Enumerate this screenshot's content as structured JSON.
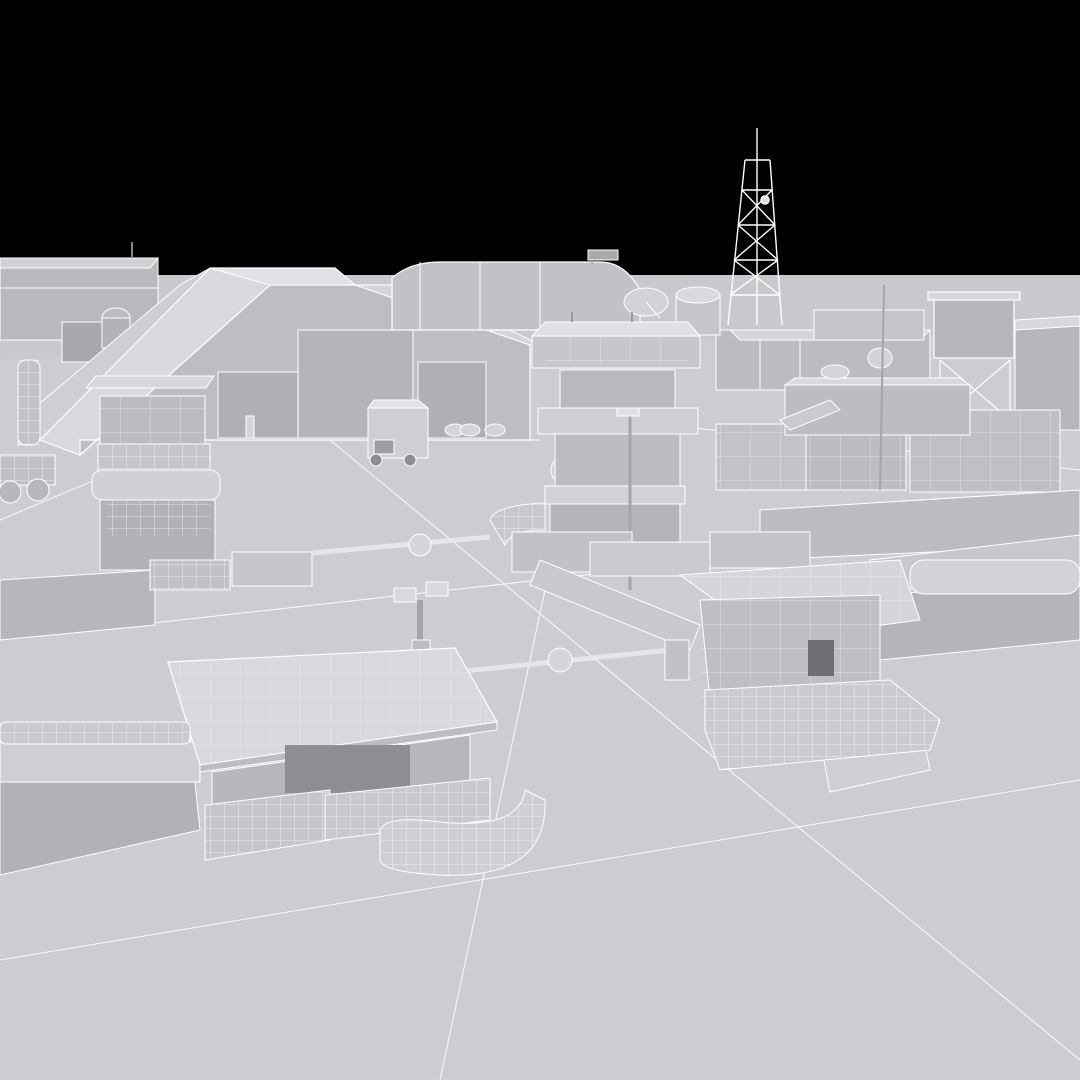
{
  "scene": {
    "render_style": "clay-wireframe",
    "background_color": "#000000",
    "model_color": "#c4c4c8",
    "wire_color": "#ffffff",
    "objects": [
      "ground-plane",
      "hangar-bunker",
      "control-tower",
      "radio-mast",
      "guard-tower",
      "guard-post",
      "entry-gate-barrier",
      "bunker-shelter",
      "sandbag-wall",
      "concrete-barrier",
      "military-truck",
      "armored-vehicle",
      "water-tank",
      "radar-dish",
      "floodlight-pole",
      "barracks-building",
      "watchtower-scaffold",
      "perimeter-wall",
      "shipping-container",
      "oil-barrels"
    ]
  }
}
